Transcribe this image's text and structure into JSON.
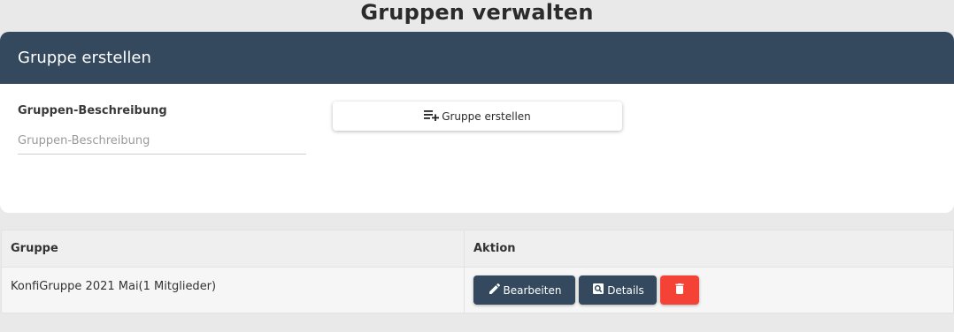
{
  "page": {
    "title": "Gruppen verwalten"
  },
  "create_card": {
    "header": "Gruppe erstellen",
    "field_label": "Gruppen-Beschreibung",
    "field_placeholder": "Gruppen-Beschreibung",
    "field_value": "",
    "create_button_label": "Gruppe erstellen",
    "create_button_icon": "playlist-add-icon"
  },
  "table": {
    "headers": [
      "Gruppe",
      "Aktion"
    ],
    "rows": [
      {
        "name": "KonfiGruppe 2021 Mai(1 Mitglieder)",
        "actions": {
          "edit_label": "Bearbeiten",
          "edit_icon": "pencil-icon",
          "details_label": "Details",
          "details_icon": "search-icon",
          "delete_icon": "trash-icon"
        }
      }
    ]
  },
  "colors": {
    "header_bg": "#34495e",
    "delete_bg": "#f44336",
    "page_bg": "#e9e9e9"
  }
}
